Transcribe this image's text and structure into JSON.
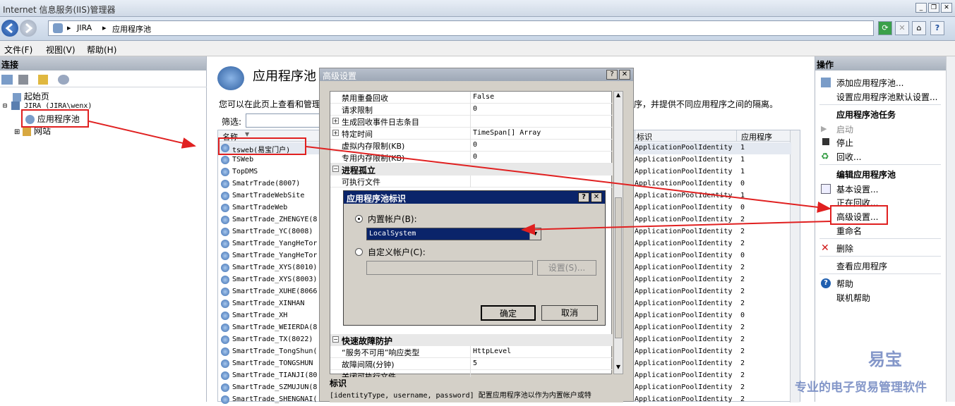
{
  "window": {
    "title": "Internet 信息服务(IIS)管理器"
  },
  "address": {
    "segments": [
      "JIRA",
      "应用程序池"
    ]
  },
  "menu": [
    "文件(F)",
    "视图(V)",
    "帮助(H)"
  ],
  "connections": {
    "header": "连接",
    "tree": [
      "起始页",
      "JIRA (JIRA\\wenx)",
      "应用程序池",
      "网站"
    ]
  },
  "main": {
    "title": "应用程序池",
    "description": "您可以在此页上查看和管理",
    "description_tail": "序，并提供不同应用程序之间的隔离。",
    "filter_label": "筛选:",
    "columns": [
      "名称",
      "标识",
      "应用程序"
    ],
    "rows": [
      {
        "name": "tsweb(易宝门户)",
        "identity": "ApplicationPoolIdentity",
        "apps": "1"
      },
      {
        "name": "TSWeb",
        "identity": "ApplicationPoolIdentity",
        "apps": "1"
      },
      {
        "name": "TopDMS",
        "identity": "ApplicationPoolIdentity",
        "apps": "1"
      },
      {
        "name": "SmatrTrade(8007)",
        "identity": "ApplicationPoolIdentity",
        "apps": "0"
      },
      {
        "name": "SmartTradeWebSite",
        "identity": "ApplicationPoolIdentity",
        "apps": "1"
      },
      {
        "name": "SmartTradeWeb",
        "identity": "ApplicationPoolIdentity",
        "apps": "0"
      },
      {
        "name": "SmartTrade_ZHENGYE(8",
        "identity": "ApplicationPoolIdentity",
        "apps": "2"
      },
      {
        "name": "SmartTrade_YC(8008)",
        "identity": "ApplicationPoolIdentity",
        "apps": "2"
      },
      {
        "name": "SmartTrade_YangHeTor",
        "identity": "ApplicationPoolIdentity",
        "apps": "2"
      },
      {
        "name": "SmartTrade_YangHeTor",
        "identity": "ApplicationPoolIdentity",
        "apps": "0"
      },
      {
        "name": "SmartTrade_XYS(8010)",
        "identity": "ApplicationPoolIdentity",
        "apps": "2"
      },
      {
        "name": "SmartTrade_XYS(8003)",
        "identity": "ApplicationPoolIdentity",
        "apps": "2"
      },
      {
        "name": "SmartTrade_XUHE(8066",
        "identity": "ApplicationPoolIdentity",
        "apps": "2"
      },
      {
        "name": "SmartTrade_XINHAN",
        "identity": "ApplicationPoolIdentity",
        "apps": "2"
      },
      {
        "name": "SmartTrade_XH",
        "identity": "ApplicationPoolIdentity",
        "apps": "0"
      },
      {
        "name": "SmartTrade_WEIERDA(8",
        "identity": "ApplicationPoolIdentity",
        "apps": "2"
      },
      {
        "name": "SmartTrade_TX(8022)",
        "identity": "ApplicationPoolIdentity",
        "apps": "2"
      },
      {
        "name": "SmartTrade_TongShun(",
        "identity": "ApplicationPoolIdentity",
        "apps": "2"
      },
      {
        "name": "SmartTrade_TONGSHUN",
        "identity": "ApplicationPoolIdentity",
        "apps": "2"
      },
      {
        "name": "SmartTrade_TIANJI(80",
        "identity": "ApplicationPoolIdentity",
        "apps": "2"
      },
      {
        "name": "SmartTrade_SZMUJUN(8",
        "identity": "ApplicationPoolIdentity",
        "apps": "2"
      },
      {
        "name": "SmartTrade_SHENGNAI(",
        "identity": "ApplicationPoolIdentity",
        "apps": "2"
      }
    ]
  },
  "actions": {
    "header": "操作",
    "add_pool": "添加应用程序池...",
    "set_defaults": "设置应用程序池默认设置...",
    "tasks_header": "应用程序池任务",
    "start": "启动",
    "stop": "停止",
    "recycle": "回收...",
    "edit_header": "编辑应用程序池",
    "basic": "基本设置...",
    "recycling": "正在回收...",
    "advanced": "高级设置...",
    "rename": "重命名",
    "delete": "删除",
    "view_apps": "查看应用程序",
    "help": "帮助",
    "online_help": "联机帮助"
  },
  "advanced_dialog": {
    "title": "高级设置",
    "props": [
      {
        "type": "prop",
        "key": "禁用重叠回收",
        "value": "False"
      },
      {
        "type": "prop",
        "key": "请求限制",
        "value": "0"
      },
      {
        "type": "propplus",
        "key": "生成回收事件日志条目",
        "value": ""
      },
      {
        "type": "propplus",
        "key": "特定时间",
        "value": "TimeSpan[] Array"
      },
      {
        "type": "prop",
        "key": "虚拟内存限制(KB)",
        "value": "0"
      },
      {
        "type": "prop",
        "key": "专用内存限制(KB)",
        "value": "0"
      },
      {
        "type": "cat",
        "key": "进程孤立",
        "value": ""
      },
      {
        "type": "prop",
        "key": "可执行文件",
        "value": ""
      }
    ],
    "props_bottom": [
      {
        "type": "cat",
        "key": "快速故障防护",
        "value": ""
      },
      {
        "type": "prop",
        "key": "“服务不可用”响应类型",
        "value": "HttpLevel"
      },
      {
        "type": "prop",
        "key": "故障间隔(分钟)",
        "value": "5"
      },
      {
        "type": "prop",
        "key": "关闭可执行文件",
        "value": ""
      }
    ],
    "desc_title": "标识",
    "desc_text": "[identityType, username, password] 配置应用程序池以作为内置帐户或特"
  },
  "identity_dialog": {
    "title": "应用程序池标识",
    "builtin_label": "内置帐户(B):",
    "builtin_value": "LocalSystem",
    "custom_label": "自定义帐户(C):",
    "set_button": "设置(S)...",
    "ok": "确定",
    "cancel": "取消"
  },
  "watermark": {
    "brand": "易宝",
    "tagline": "专业的电子贸易管理软件"
  },
  "colors": {
    "annotation": "#e02020",
    "watermark": "#6f86c0",
    "dialog_title": "#0a246a"
  }
}
